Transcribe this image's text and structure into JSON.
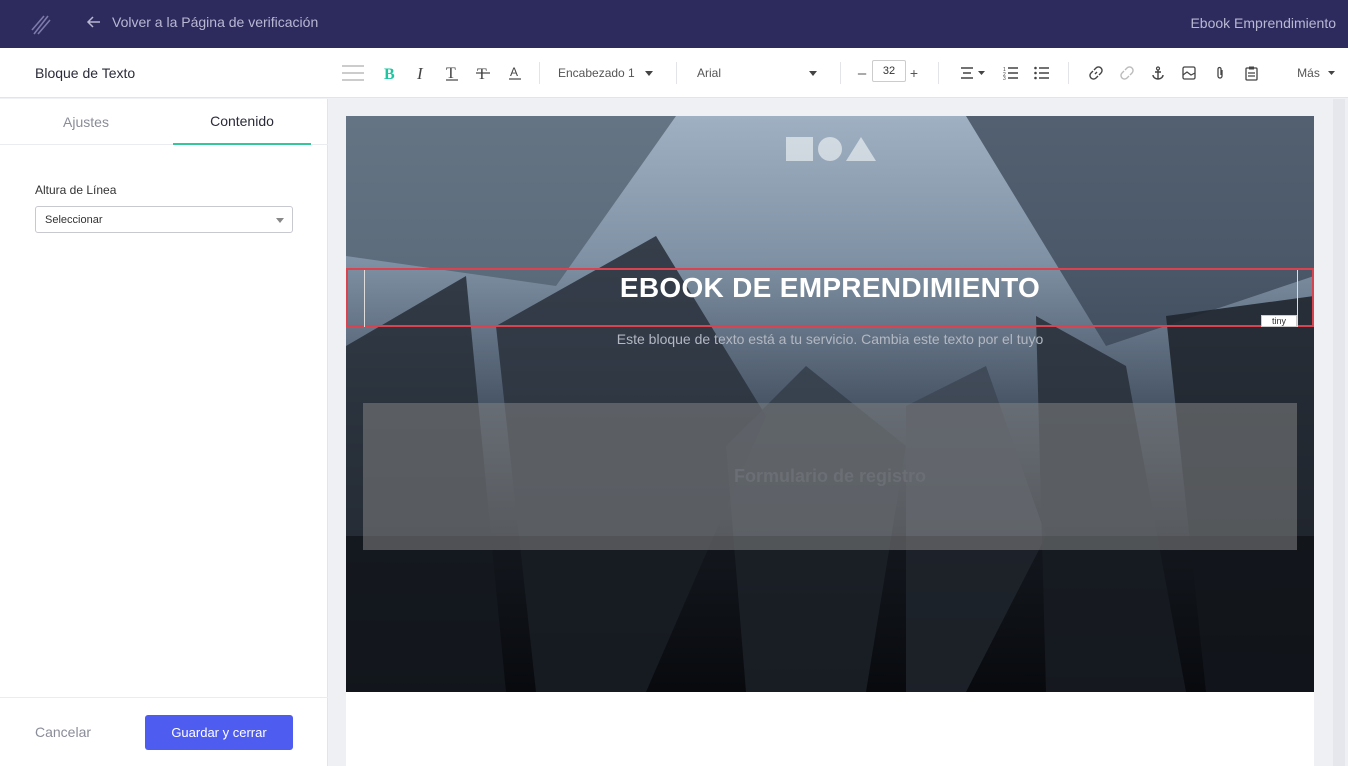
{
  "topbar": {
    "back_label": "Volver a la Página de verificación",
    "project_title": "Ebook Emprendimiento"
  },
  "toolbar": {
    "block_title": "Bloque de Texto",
    "block_format": "Encabezado 1",
    "font_family": "Arial",
    "font_size": "32",
    "more_label": "Más",
    "accent_color": "#1fc4a0"
  },
  "left_panel": {
    "tabs": [
      {
        "label": "Ajustes",
        "active": false
      },
      {
        "label": "Contenido",
        "active": true
      }
    ],
    "line_height_label": "Altura de Línea",
    "line_height_placeholder": "Seleccionar",
    "cancel_label": "Cancelar",
    "save_label": "Guardar y cerrar"
  },
  "canvas": {
    "headline": "EBOOK DE EMPRENDIMIENTO",
    "subtitle": "Este bloque de texto está a tu servicio. Cambia este texto por el tuyo",
    "form_placeholder": "Formulario de registro",
    "tiny_badge": "tiny"
  },
  "colors": {
    "topbar_bg": "#2d2a5e",
    "primary_button": "#4f5cf0",
    "active_tab_underline": "#34c79a",
    "selection_border": "#d9424f"
  }
}
